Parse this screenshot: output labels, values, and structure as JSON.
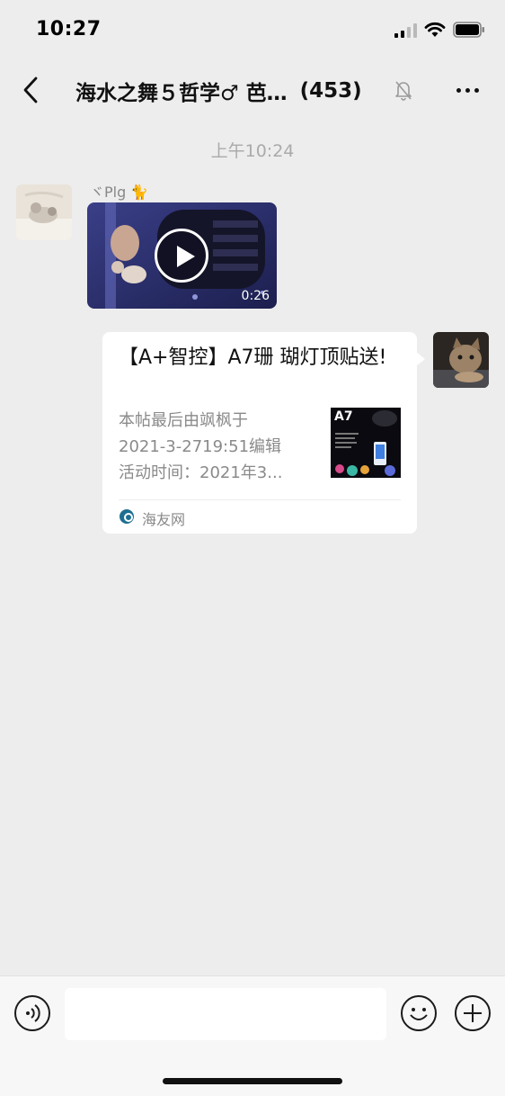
{
  "status_bar": {
    "time": "10:27"
  },
  "nav": {
    "title": "海水之舞５哲学♂ 芭…",
    "member_count": "(453)",
    "icons": {
      "back": "chevron-left-icon",
      "mute": "bell-muted-icon",
      "more": "more-dots-icon"
    }
  },
  "chat": {
    "timestamp": "上午10:24",
    "messages": [
      {
        "type": "video",
        "sender": "ヾPlg 🐈",
        "duration": "0:26",
        "play_icon": "play-icon"
      },
      {
        "type": "link",
        "title": "【A+智控】A7珊 瑚灯顶贴送!",
        "desc_lines": [
          "本帖最后由飒枫于",
          "2021-3-2719:51编辑",
          "活动时间：2021年3..."
        ],
        "thumb_text": "A7",
        "source": "海友网"
      }
    ]
  },
  "input_bar": {
    "placeholder": "",
    "icons": {
      "voice": "voice-icon",
      "emoji": "emoji-icon",
      "plus": "plus-icon"
    }
  },
  "colors": {
    "background": "#ededed",
    "bubble": "#ffffff",
    "meta_text": "#888888"
  }
}
